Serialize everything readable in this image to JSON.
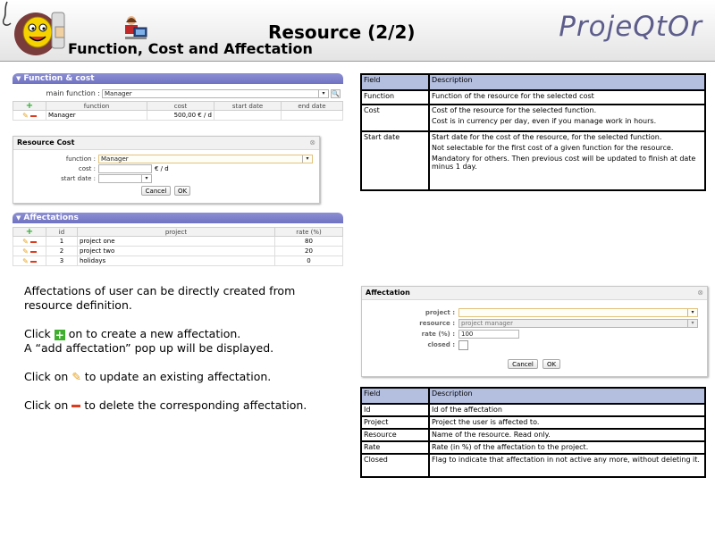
{
  "header": {
    "title": "Resource (2/2)",
    "subtitle": "Function, Cost and Affectation",
    "brand": "ProjeQtOr"
  },
  "function_cost": {
    "section_title": "Function & cost",
    "main_function_label": "main function :",
    "main_function_value": "Manager",
    "columns": [
      "function",
      "cost",
      "start date",
      "end date"
    ],
    "rows": [
      {
        "function": "Manager",
        "cost": "500,00 € / d",
        "start": "",
        "end": ""
      }
    ]
  },
  "resource_cost_dialog": {
    "title": "Resource Cost",
    "function_label": "function :",
    "function_value": "Manager",
    "cost_label": "cost :",
    "cost_unit": "€ / d",
    "start_date_label": "start date :",
    "cancel": "Cancel",
    "ok": "OK"
  },
  "affectations": {
    "section_title": "Affectations",
    "columns": [
      "id",
      "project",
      "rate (%)"
    ],
    "rows": [
      {
        "id": "1",
        "project": "project one",
        "rate": "80"
      },
      {
        "id": "2",
        "project": "project two",
        "rate": "20"
      },
      {
        "id": "3",
        "project": "holidays",
        "rate": "0"
      }
    ]
  },
  "explanation": {
    "p1a": "Affectations of user can be directly created from",
    "p1b": "resource definition.",
    "p2a_pre": "Click",
    "p2a_post": "on to create a new affectation.",
    "p2b": "A “add affectation” pop up will be displayed.",
    "p3_pre": "Click on",
    "p3_post": "to update an existing affectation.",
    "p4_pre": "Click on",
    "p4_post": "to delete the corresponding affectation."
  },
  "cost_fields_table": {
    "headers": [
      "Field",
      "Description"
    ],
    "rows": [
      {
        "field": "Function",
        "desc": [
          "Function of the resource for the selected cost"
        ]
      },
      {
        "field": "Cost",
        "desc": [
          "Cost of the resource for the selected function.",
          "Cost is in currency per day, even if you manage work in hours."
        ]
      },
      {
        "field": "Start date",
        "desc": [
          "Start date for the cost of the resource, for the selected function.",
          "Not selectable for the first cost of a given function for the resource.",
          "Mandatory for others. Then previous cost will be updated to finish at date minus 1 day."
        ]
      }
    ]
  },
  "affectation_dialog": {
    "title": "Affectation",
    "project_label": "project :",
    "project_value": "",
    "resource_label": "resource :",
    "resource_value": "project manager",
    "rate_label": "rate (%) :",
    "rate_value": "100",
    "closed_label": "closed :",
    "cancel": "Cancel",
    "ok": "OK"
  },
  "affectation_fields_table": {
    "headers": [
      "Field",
      "Description"
    ],
    "rows": [
      {
        "field": "Id",
        "desc": "Id of the affectation"
      },
      {
        "field": "Project",
        "desc": "Project the user is affected to."
      },
      {
        "field": "Resource",
        "desc": "Name of the resource. Read only."
      },
      {
        "field": "Rate",
        "desc": "Rate (in %) of the affectation to the project."
      },
      {
        "field": "Closed",
        "desc": "Flag to indicate that affectation in not active any more, without deleting it."
      }
    ]
  },
  "colors": {
    "section_header": "#7b7ec9",
    "table_header": "#b4bfe0",
    "brand": "#5d5d8c"
  }
}
